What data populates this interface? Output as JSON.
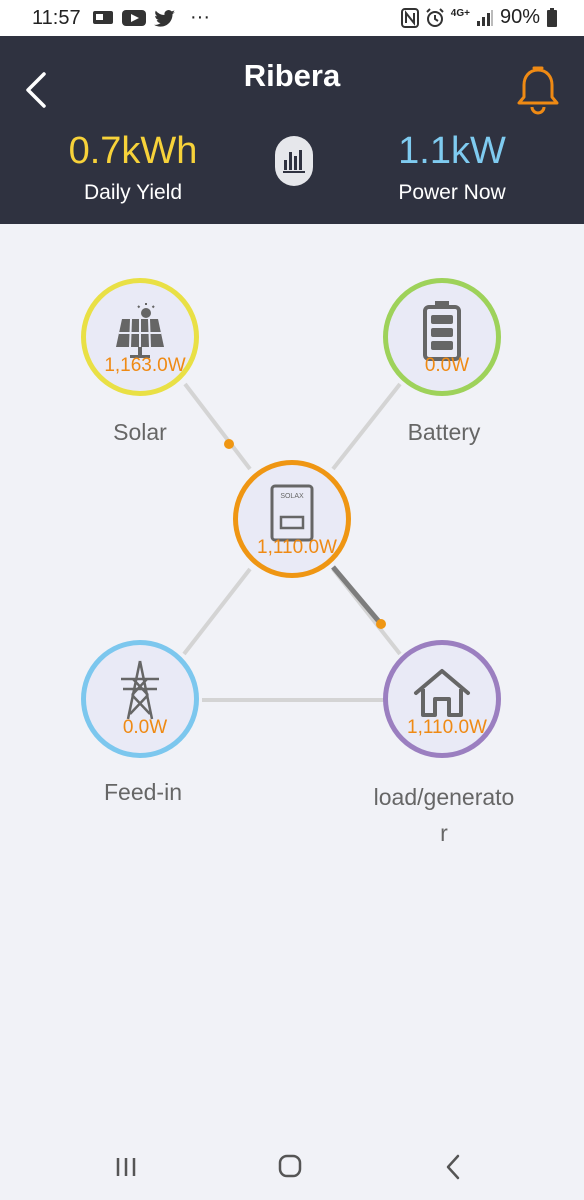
{
  "status_bar": {
    "time": "11:57",
    "dots": "···",
    "battery_pct": "90%",
    "network": "4G+"
  },
  "header": {
    "title": "Ribera",
    "daily_yield": {
      "value": "0.7kWh",
      "label": "Daily Yield"
    },
    "power_now": {
      "value": "1.1kW",
      "label": "Power Now"
    }
  },
  "nodes": {
    "solar": {
      "power": "1,163.0W",
      "label": "Solar",
      "color": "#e9e045"
    },
    "battery": {
      "power": "0.0W",
      "label": "Battery",
      "color": "#9ed25a"
    },
    "inverter": {
      "power": "1,110.0W",
      "brand": "SOLAX",
      "color": "#ef9613"
    },
    "feedin": {
      "power": "0.0W",
      "label": "Feed-in",
      "color": "#7cc7ee"
    },
    "load": {
      "power": "1,110.0W",
      "label_line1": "load/generato",
      "label_line2": "r",
      "color": "#9b7fc0"
    }
  },
  "colors": {
    "header_bg": "#2f3240",
    "yield": "#f7d23a",
    "power_now": "#7fcbf0",
    "accent": "#ef8a14",
    "page_bg": "#f1f2f7"
  }
}
